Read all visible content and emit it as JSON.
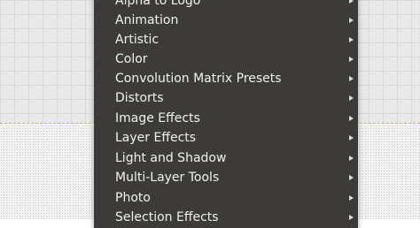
{
  "menu": {
    "items": [
      {
        "label": "Alpha to Logo"
      },
      {
        "label": "Animation"
      },
      {
        "label": "Artistic"
      },
      {
        "label": "Color"
      },
      {
        "label": "Convolution Matrix Presets"
      },
      {
        "label": "Distorts"
      },
      {
        "label": "Image Effects"
      },
      {
        "label": "Layer Effects"
      },
      {
        "label": "Light and Shadow"
      },
      {
        "label": "Multi-Layer Tools"
      },
      {
        "label": "Photo"
      },
      {
        "label": "Selection Effects"
      }
    ],
    "submenu_icon": "chevron-right-icon"
  },
  "colors": {
    "menu_background": "#3c3b37",
    "menu_text": "#f2f1f0",
    "canvas_border": "#bdbd3a"
  }
}
